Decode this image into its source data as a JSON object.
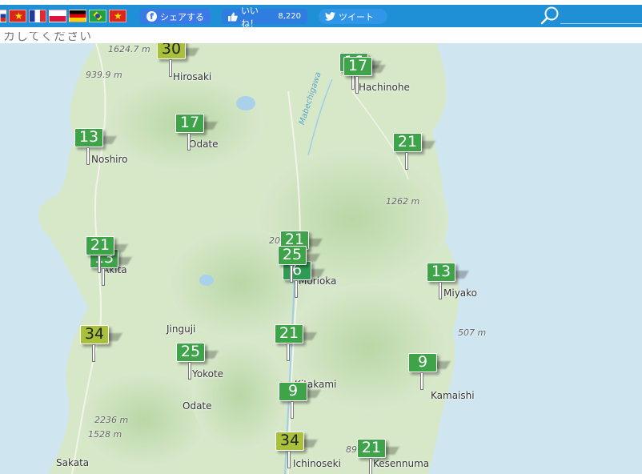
{
  "header": {
    "flags": [
      "ru-flag",
      "vn-flag",
      "fr-flag",
      "pl-flag",
      "de-flag",
      "br-flag",
      "vn-flag"
    ],
    "facebook_share_label": "シェアする",
    "like_label": "いいね！",
    "like_count": "8,220",
    "tweet_label": "ツイート",
    "banner_text": "カしてください"
  },
  "map": {
    "places": [
      {
        "id": "hirosaki",
        "label": "Hirosaki"
      },
      {
        "id": "hachinohe",
        "label": "Hachinohe"
      },
      {
        "id": "noshiro",
        "label": "Noshiro"
      },
      {
        "id": "odate",
        "label": "Odate"
      },
      {
        "id": "akita",
        "label": "Akita"
      },
      {
        "id": "morioka",
        "label": "Morioka"
      },
      {
        "id": "miyako",
        "label": "Miyako"
      },
      {
        "id": "jinguji",
        "label": "Jinguji"
      },
      {
        "id": "yokote",
        "label": "Yokote"
      },
      {
        "id": "kitakami",
        "label": "Kitakami"
      },
      {
        "id": "kamaishi",
        "label": "Kamaishi"
      },
      {
        "id": "odate2",
        "label": "Odate"
      },
      {
        "id": "sakata",
        "label": "Sakata"
      },
      {
        "id": "ichinoseki",
        "label": "Ichinoseki"
      },
      {
        "id": "kesennuma",
        "label": "Kesennuma"
      }
    ],
    "elevations": [
      {
        "id": "e1",
        "label": "1624.7 m"
      },
      {
        "id": "e2",
        "label": "939.9 m"
      },
      {
        "id": "e3",
        "label": "1262 m"
      },
      {
        "id": "e4",
        "label": "507 m"
      },
      {
        "id": "e5",
        "label": "2236 m"
      },
      {
        "id": "e6",
        "label": "1528 m"
      },
      {
        "id": "e7",
        "label": "20"
      },
      {
        "id": "e8",
        "label": "89"
      }
    ],
    "rivers": [
      {
        "id": "mabechi",
        "label": "Mabechigawa"
      }
    ],
    "markers": [
      {
        "id": "m1",
        "value": "30",
        "color": "yg"
      },
      {
        "id": "m2",
        "value": "16",
        "color": "green"
      },
      {
        "id": "m3",
        "value": "17",
        "color": "green"
      },
      {
        "id": "m4",
        "value": "17",
        "color": "green"
      },
      {
        "id": "m5",
        "value": "13",
        "color": "green"
      },
      {
        "id": "m6",
        "value": "21",
        "color": "green"
      },
      {
        "id": "m7",
        "value": "13",
        "color": "green"
      },
      {
        "id": "m8",
        "value": "21",
        "color": "green"
      },
      {
        "id": "m9",
        "value": "21",
        "color": "green"
      },
      {
        "id": "m10",
        "value": "6",
        "color": "dgreen"
      },
      {
        "id": "m11",
        "value": "25",
        "color": "green"
      },
      {
        "id": "m12",
        "value": "13",
        "color": "green"
      },
      {
        "id": "m13",
        "value": "34",
        "color": "yg"
      },
      {
        "id": "m14",
        "value": "21",
        "color": "green"
      },
      {
        "id": "m15",
        "value": "25",
        "color": "green"
      },
      {
        "id": "m16",
        "value": "9",
        "color": "green"
      },
      {
        "id": "m17",
        "value": "9",
        "color": "green"
      },
      {
        "id": "m18",
        "value": "34",
        "color": "yg"
      },
      {
        "id": "m19",
        "value": "21",
        "color": "green"
      }
    ]
  }
}
